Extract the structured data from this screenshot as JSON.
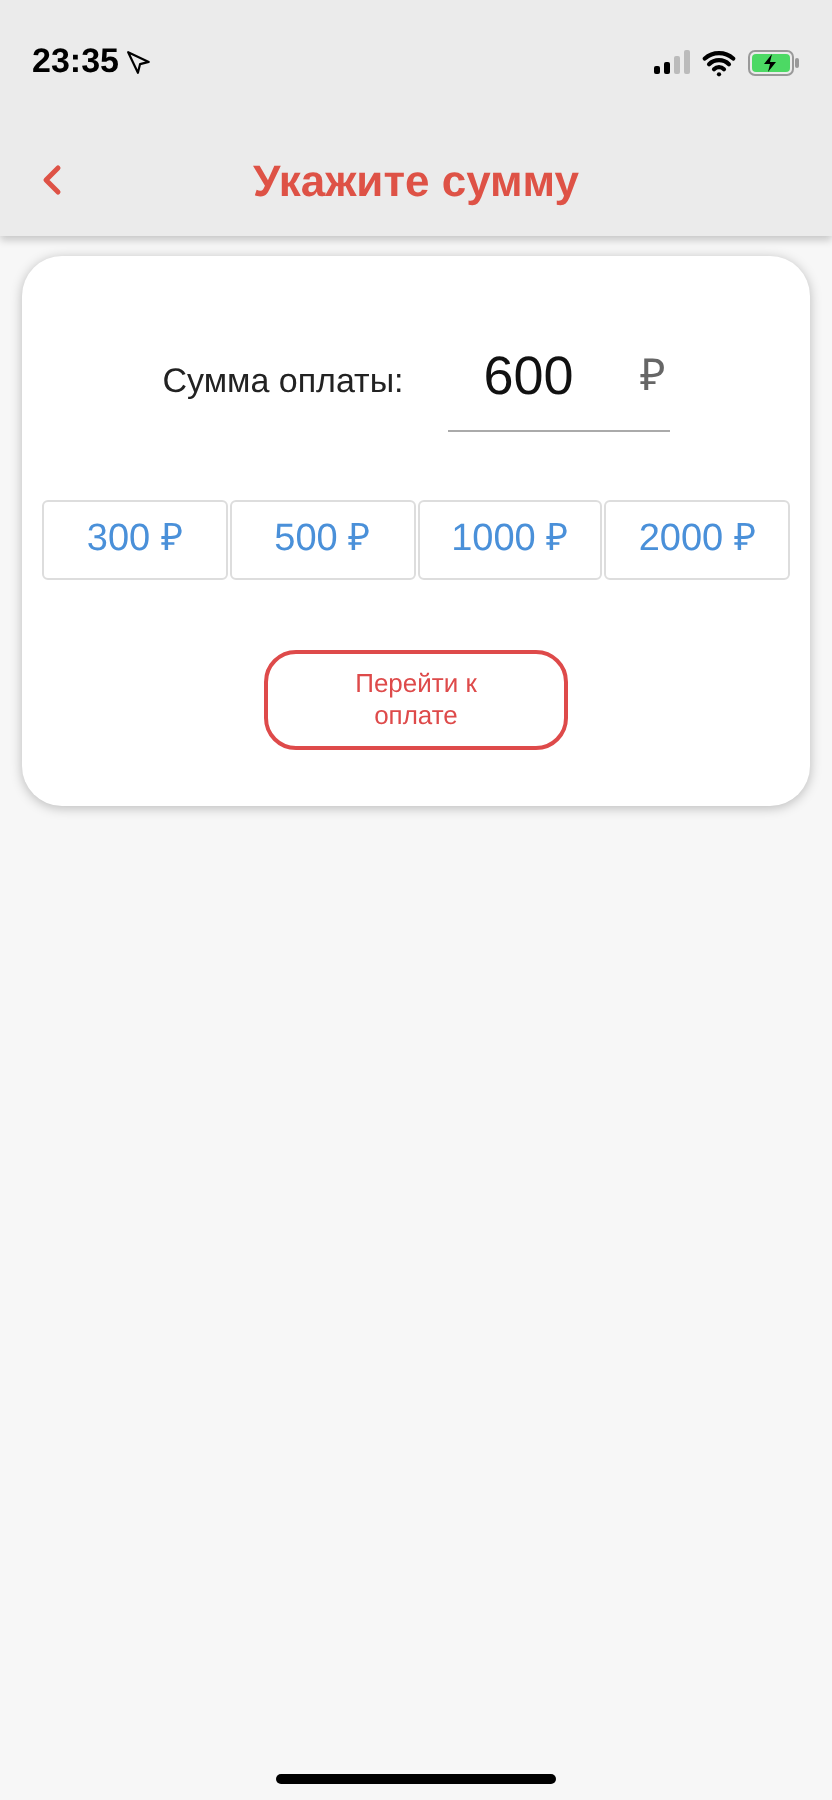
{
  "status_bar": {
    "time": "23:35"
  },
  "header": {
    "title": "Укажите сумму"
  },
  "amount": {
    "label": "Сумма оплаты:",
    "value": "600",
    "currency": "₽"
  },
  "presets": [
    {
      "label": "300 ₽"
    },
    {
      "label": "500 ₽"
    },
    {
      "label": "1000 ₽"
    },
    {
      "label": "2000 ₽"
    }
  ],
  "pay_button": {
    "label": "Перейти к оплате"
  }
}
